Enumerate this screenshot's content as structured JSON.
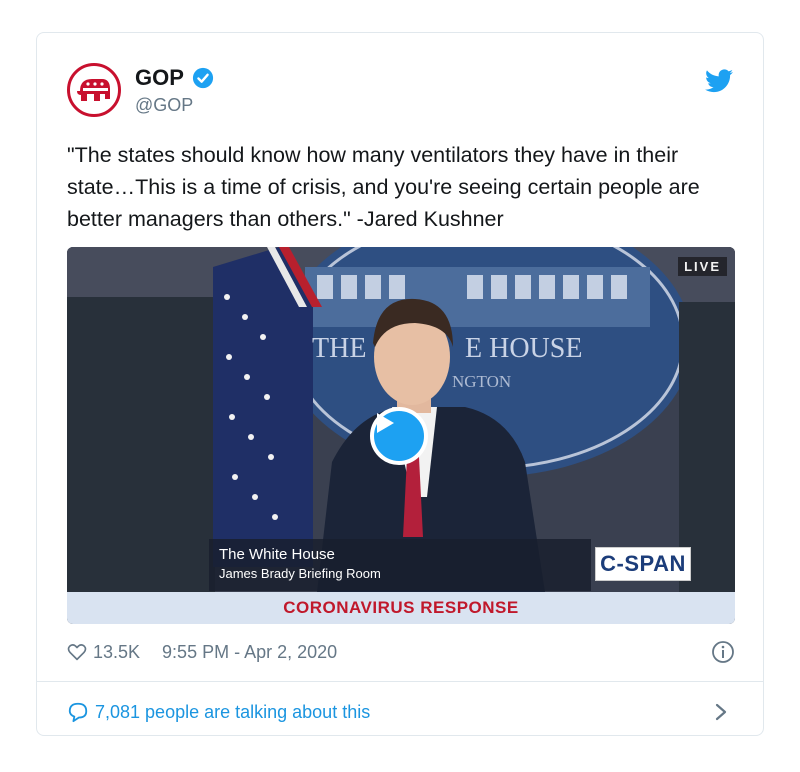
{
  "tweet": {
    "display_name": "GOP",
    "handle": "@GOP",
    "verified": true,
    "verified_icon": "verified-badge-icon",
    "avatar_icon": "republican-elephant-logo",
    "text": "\"The states should know how many ventilators they have in their state…This is a time of crisis, and you're seeing certain people are better managers than others.\" -Jared Kushner",
    "likes": "13.5K",
    "timestamp": "9:55 PM - Apr 2, 2020",
    "conversation_label": "7,081 people are talking about this"
  },
  "media": {
    "live_label": "LIVE",
    "backdrop_text_1": "THE",
    "backdrop_text_2": "E HOUSE",
    "backdrop_text_3": "NGTON",
    "lower_third_title": "The White House",
    "lower_third_subtitle": "James Brady Briefing Room",
    "network_logo": "C-SPAN",
    "banner_text": "CORONAVIRUS RESPONSE"
  },
  "colors": {
    "accent": "#1da1f2",
    "link": "#1b95e0",
    "muted": "#657786",
    "gop_red": "#c8102e"
  }
}
